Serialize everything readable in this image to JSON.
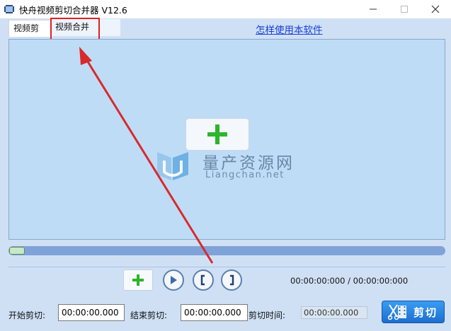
{
  "window": {
    "title": "快舟视频剪切合并器 V12.6",
    "minimize_icon": "minimize-icon",
    "maximize_icon": "maximize-icon",
    "close_icon": "close-icon"
  },
  "tabs": [
    {
      "label": "视频剪切",
      "active": true
    },
    {
      "label": "视频合并",
      "active": false
    }
  ],
  "help_link": "怎样使用本软件",
  "watermark": {
    "text": "量产资源网",
    "url": "Liangchan.net"
  },
  "player": {
    "progress": 0.0,
    "time_display": "00:00:00:000 / 00:00:00:000"
  },
  "controls": {
    "add_icon": "plus-icon",
    "play_icon": "play-icon",
    "mark_in_icon": "bracket-left-icon",
    "mark_out_icon": "bracket-right-icon"
  },
  "bottom": {
    "start_label": "开始剪切:",
    "start_value": "00:00:00.000",
    "end_label": "结束剪切:",
    "end_value": "00:00:00.000",
    "duration_label": "剪切时间:",
    "duration_value": "00:00:00.000",
    "cut_button": "剪切"
  },
  "colors": {
    "accent": "#1d6fd0",
    "preview_bg": "#bfdcf7",
    "annotation": "#e02020",
    "plus_green": "#2db52d"
  }
}
